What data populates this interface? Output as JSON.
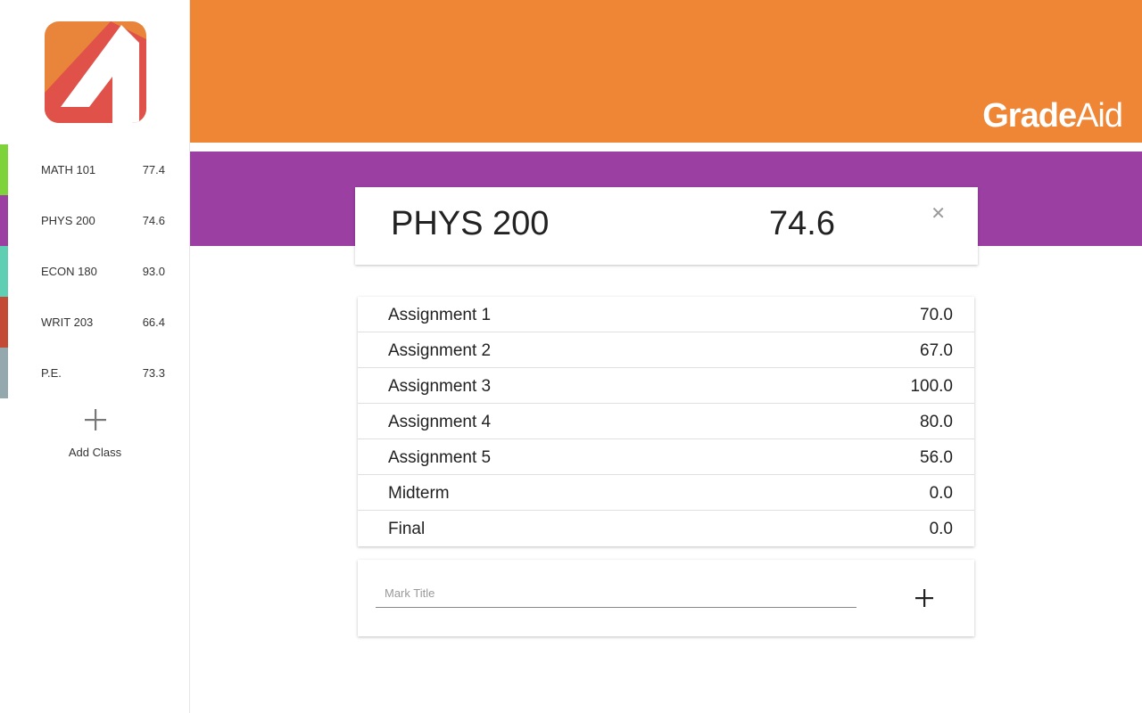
{
  "app": {
    "brand_bold": "Grade",
    "brand_light": "Aid"
  },
  "sidebar": {
    "classes": [
      {
        "name": "MATH 101",
        "grade": "77.4",
        "color": "#7ed33b"
      },
      {
        "name": "PHYS 200",
        "grade": "74.6",
        "color": "#9b3fa3"
      },
      {
        "name": "ECON 180",
        "grade": "93.0",
        "color": "#5fcfb3"
      },
      {
        "name": "WRIT 203",
        "grade": "66.4",
        "color": "#c34a35"
      },
      {
        "name": "P.E.",
        "grade": "73.3",
        "color": "#93a9ad"
      }
    ],
    "add_class_label": "Add Class"
  },
  "class_card": {
    "title": "PHYS 200",
    "average": "74.6",
    "close_icon": "close-icon"
  },
  "marks": [
    {
      "name": "Assignment 1",
      "value": "70.0"
    },
    {
      "name": "Assignment 2",
      "value": "67.0"
    },
    {
      "name": "Assignment 3",
      "value": "100.0"
    },
    {
      "name": "Assignment 4",
      "value": "80.0"
    },
    {
      "name": "Assignment 5",
      "value": "56.0"
    },
    {
      "name": "Midterm",
      "value": "0.0"
    },
    {
      "name": "Final",
      "value": "0.0"
    }
  ],
  "add_mark": {
    "placeholder": "Mark Title"
  },
  "colors": {
    "header": "#ee8636",
    "accent": "#9b3fa3",
    "logo_orange": "#e9853a",
    "logo_red": "#e0514a"
  }
}
